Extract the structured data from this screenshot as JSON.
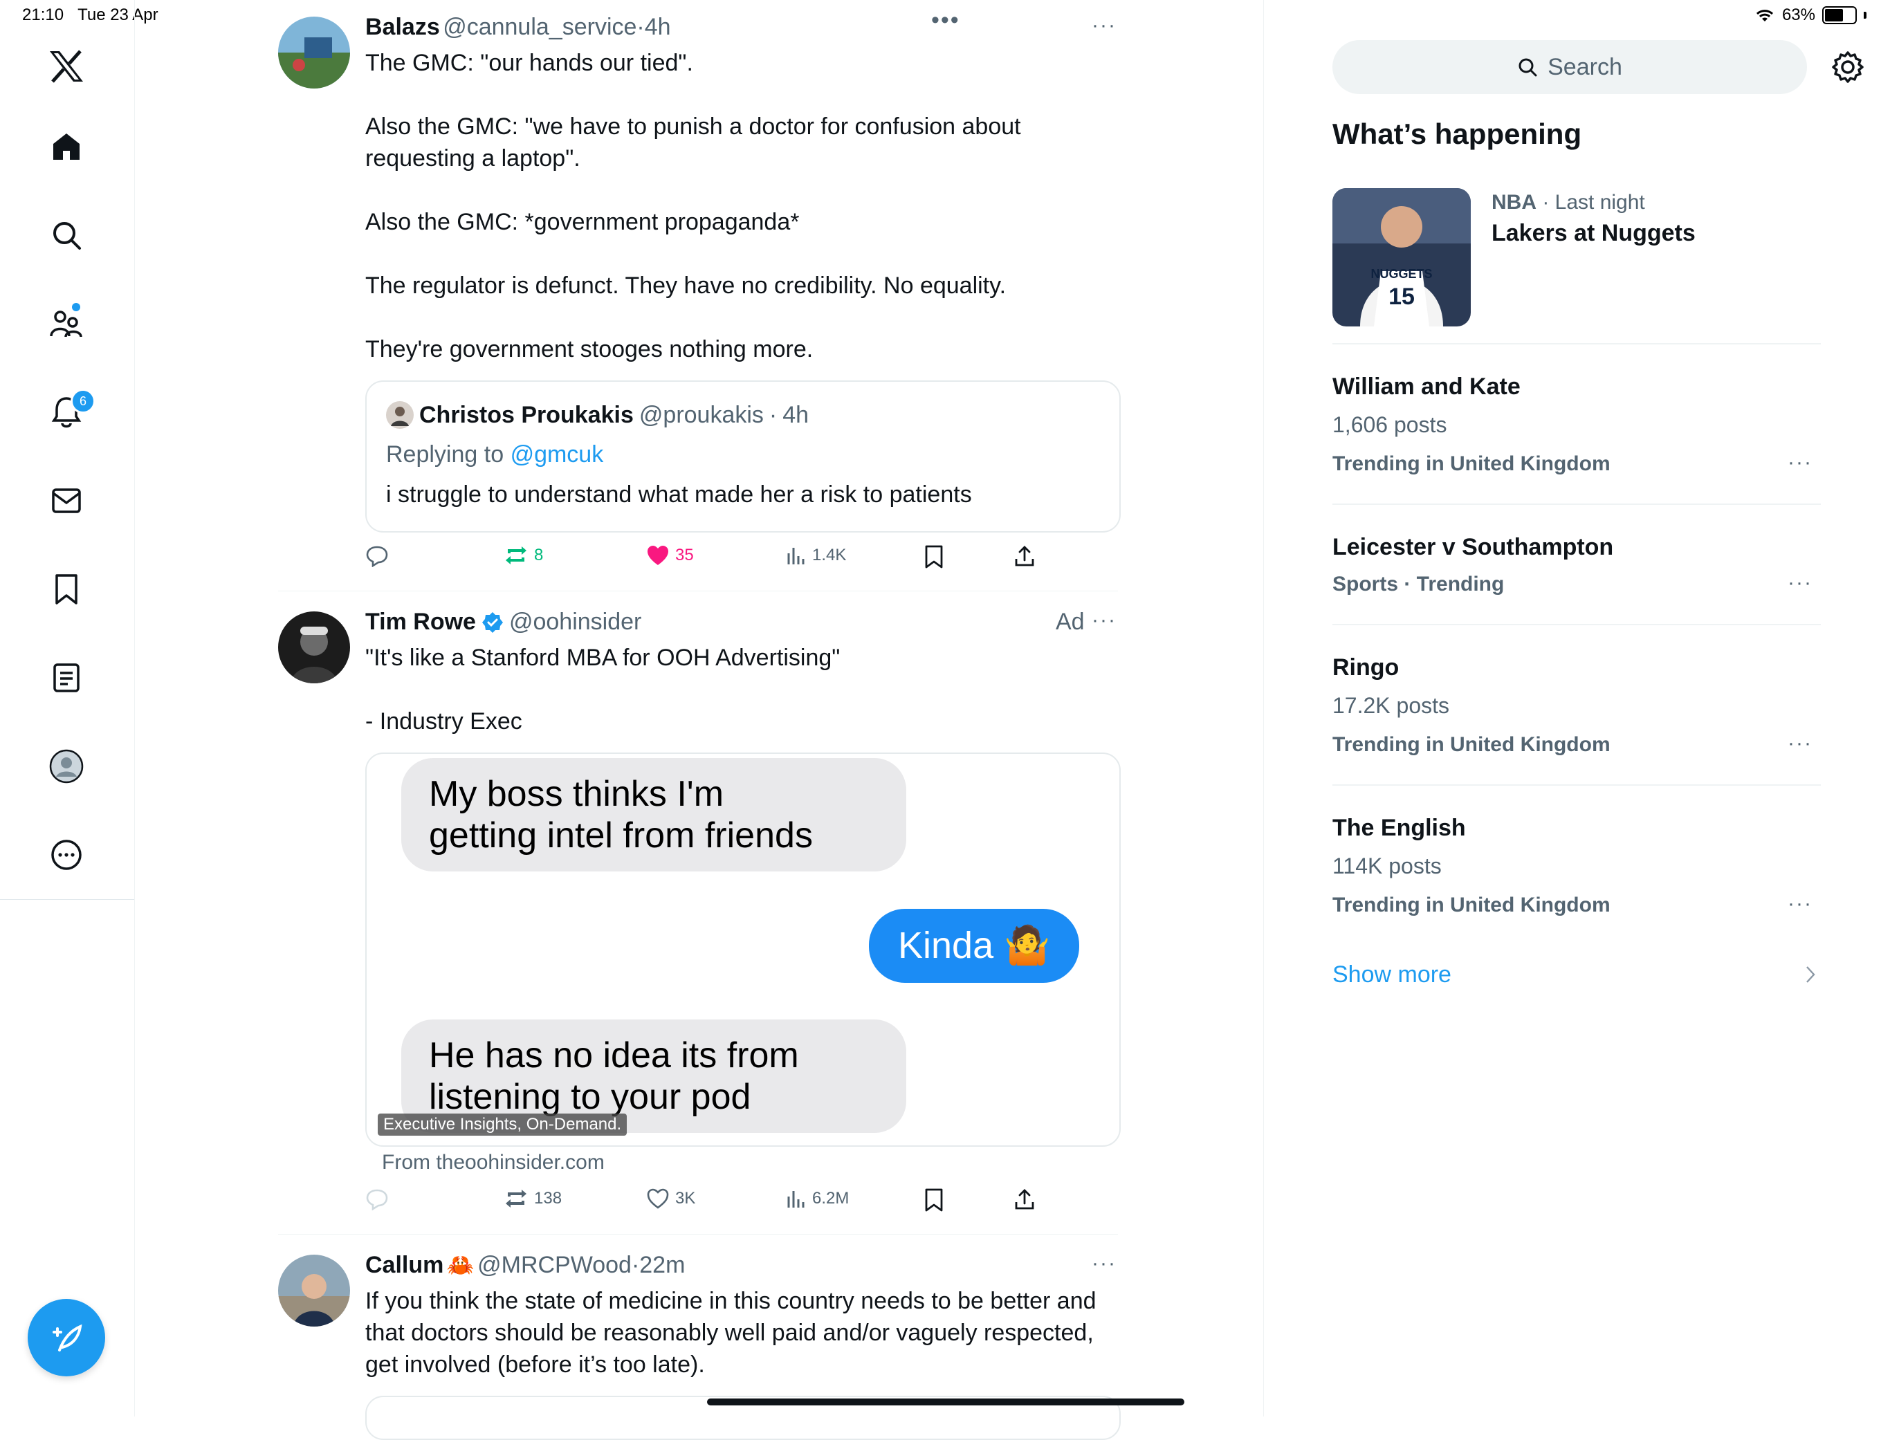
{
  "status": {
    "time": "21:10",
    "date": "Tue 23 Apr",
    "battery": "63%"
  },
  "nav": {
    "items": [
      "x-logo",
      "home",
      "explore",
      "communities",
      "notifications",
      "messages",
      "bookmarks",
      "lists",
      "profile",
      "more"
    ],
    "communities_badge": "",
    "notifications_badge": "6"
  },
  "timeline": {
    "posts": [
      {
        "name": "Balazs",
        "handle": "@cannula_service",
        "time": "4h",
        "text": "The GMC: \"our hands our tied\".\n\nAlso the GMC: \"we have to punish a doctor for confusion about requesting a laptop\".\n\nAlso the GMC: *government propaganda*\n\nThe regulator is defunct. They have no credibility. No equality.\n\nThey're government stooges nothing more.",
        "quote": {
          "name": "Christos Proukakis",
          "handle": "@proukakis",
          "time": "4h",
          "replying_prefix": "Replying to",
          "replying_to": "@gmcuk",
          "text": "i struggle to understand what made her a risk to patients"
        },
        "stats": {
          "replies": "",
          "reposts": "8",
          "likes": "35",
          "views": "1.4K"
        }
      },
      {
        "name": "Tim Rowe",
        "handle": "@oohinsider",
        "ad_label": "Ad",
        "text": "\"It's like a Stanford MBA for OOH Advertising\"\n\n- Industry Exec",
        "image": {
          "bubble1": "My boss thinks I'm\ngetting intel from friends",
          "bubble2": "Kinda",
          "bubble2_emoji": "🤷",
          "bubble3": "He has no idea its from\nlistening to your pod",
          "caption": "Executive Insights, On-Demand."
        },
        "source": "From theoohinsider.com",
        "stats": {
          "replies": "",
          "reposts": "138",
          "likes": "3K",
          "views": "6.2M"
        }
      },
      {
        "name": "Callum",
        "name_emoji": "🦀",
        "handle": "@MRCPWood",
        "time": "22m",
        "text": "If you think the state of medicine in this country needs to be better and that doctors should be reasonably well paid and/or vaguely respected, get involved (before it’s too late)."
      }
    ]
  },
  "sidebar": {
    "search_placeholder": "Search",
    "section_title": "What’s happening",
    "featured": {
      "category": "NBA",
      "time": "Last night",
      "title": "Lakers at Nuggets",
      "jersey_team": "NUGGETS",
      "jersey_number": "15"
    },
    "trends": [
      {
        "title": "William and Kate",
        "posts": "1,606 posts",
        "context": "Trending in United Kingdom"
      },
      {
        "title": "Leicester v Southampton",
        "posts": "",
        "context": "Sports · Trending"
      },
      {
        "title": "Ringo",
        "posts": "17.2K posts",
        "context": "Trending in United Kingdom"
      },
      {
        "title": "The English",
        "posts": "114K posts",
        "context": "Trending in United Kingdom"
      }
    ],
    "show_more": "Show more"
  },
  "colors": {
    "accent": "#1d9bf0",
    "like": "#f91880",
    "repost": "#00ba7c",
    "text": "#0f1419",
    "muted": "#536471"
  }
}
